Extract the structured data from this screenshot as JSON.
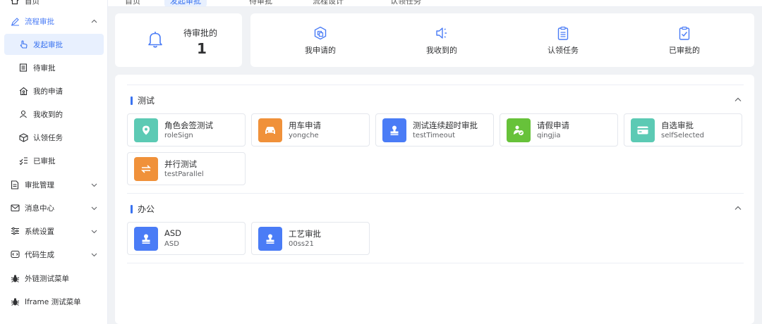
{
  "tabs": [
    {
      "label": "首页"
    },
    {
      "label": "发起审批"
    },
    {
      "label": "待审批"
    },
    {
      "label": "流程设计"
    },
    {
      "label": "认领任务"
    }
  ],
  "sidebar": {
    "items": [
      {
        "label": "首页",
        "icon": "home-icon"
      },
      {
        "label": "流程审批",
        "icon": "pen-icon"
      },
      {
        "label": "发起审批",
        "icon": "hand-icon"
      },
      {
        "label": "待审批",
        "icon": "list-icon"
      },
      {
        "label": "我的申请",
        "icon": "home-person-icon"
      },
      {
        "label": "我收到的",
        "icon": "user-icon"
      },
      {
        "label": "认领任务",
        "icon": "cube-icon"
      },
      {
        "label": "已审批",
        "icon": "checklist-icon"
      },
      {
        "label": "审批管理",
        "icon": "document-icon"
      },
      {
        "label": "消息中心",
        "icon": "mail-icon"
      },
      {
        "label": "系统设置",
        "icon": "sliders-icon"
      },
      {
        "label": "代码生成",
        "icon": "code-icon"
      },
      {
        "label": "外链测试菜单",
        "icon": "bug-icon"
      },
      {
        "label": "Iframe 测试菜单",
        "icon": "bug-icon"
      }
    ]
  },
  "pending": {
    "label": "待审批的",
    "count": "1"
  },
  "quick": [
    {
      "label": "我申请的",
      "icon": "apply-icon"
    },
    {
      "label": "我收到的",
      "icon": "speaker-icon"
    },
    {
      "label": "认领任务",
      "icon": "clipboard-icon"
    },
    {
      "label": "已审批的",
      "icon": "clipboard-check-icon"
    }
  ],
  "sections": [
    {
      "title": "测试",
      "processes": [
        {
          "name": "角色会签测试",
          "key": "roleSign",
          "color": "#5ccab4",
          "icon": "location-icon"
        },
        {
          "name": "用车申请",
          "key": "yongche",
          "color": "#f0913a",
          "icon": "car-icon"
        },
        {
          "name": "测试连续超时审批",
          "key": "testTimeout",
          "color": "#4a7cf6",
          "icon": "stamp-icon"
        },
        {
          "name": "请假申请",
          "key": "qingjia",
          "color": "#67c23a",
          "icon": "people-check-icon"
        },
        {
          "name": "自选审批",
          "key": "selfSelected",
          "color": "#5ccab4",
          "icon": "card-icon"
        },
        {
          "name": "并行测试",
          "key": "testParallel",
          "color": "#f0913a",
          "icon": "swap-icon"
        }
      ]
    },
    {
      "title": "办公",
      "processes": [
        {
          "name": "ASD",
          "key": "ASD",
          "color": "#4a7cf6",
          "icon": "stamp-icon"
        },
        {
          "name": "工艺审批",
          "key": "00ss21",
          "color": "#4a7cf6",
          "icon": "stamp-icon"
        }
      ]
    }
  ],
  "colors": {
    "accent": "#3a73f0",
    "active_bg": "#e8f0fe"
  }
}
